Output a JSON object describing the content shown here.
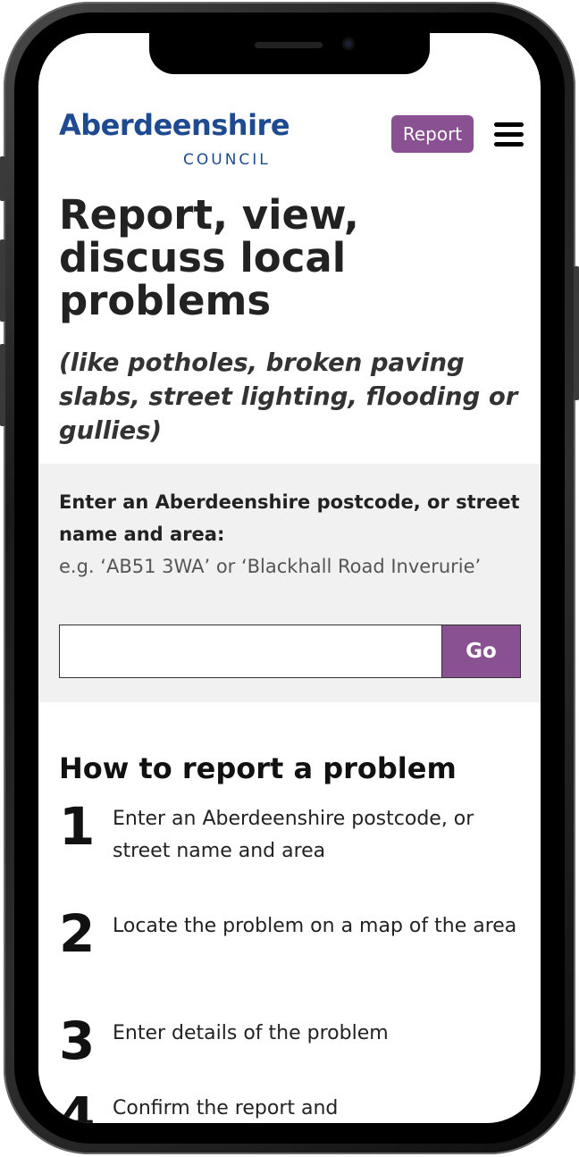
{
  "header": {
    "logo_main": "Aberdeenshire",
    "logo_sub": "COUNCIL",
    "report_button": "Report",
    "menu_icon": "hamburger-menu-icon"
  },
  "hero": {
    "headline": "Report, view, discuss local problems",
    "subheadline": "(like potholes, broken paving slabs, street lighting, flooding or gullies)"
  },
  "search": {
    "label": "Enter an Aberdeenshire postcode, or street name and area:",
    "hint": "e.g. ‘AB51 3WA’ or ‘Blackhall Road Inverurie’",
    "input_value": "",
    "go_button": "Go"
  },
  "howto": {
    "title": "How to report a problem",
    "steps": [
      {
        "number": "1",
        "text": "Enter an Aberdeenshire postcode, or street name and area"
      },
      {
        "number": "2",
        "text": "Locate the problem on a map of the area"
      },
      {
        "number": "3",
        "text": "Enter details of the problem"
      },
      {
        "number": "4",
        "text": "Confirm the report and"
      }
    ]
  },
  "colors": {
    "brand_blue": "#1e4a91",
    "accent_purple": "#8a5192",
    "form_band": "#f1f1f1"
  }
}
